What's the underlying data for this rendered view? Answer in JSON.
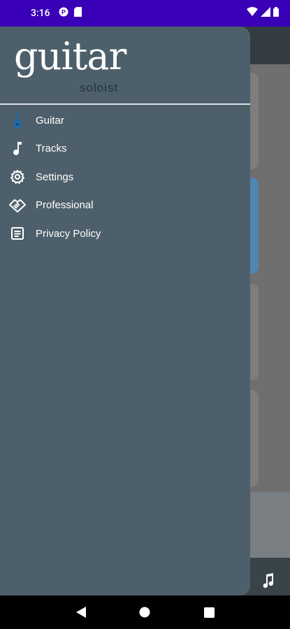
{
  "status_bar": {
    "time": "3:16",
    "left_icons": [
      "p-badge-icon",
      "sd-card-icon"
    ],
    "right_icons": [
      "wifi-icon",
      "signal-icon",
      "battery-icon"
    ]
  },
  "drawer": {
    "logo_title": "guitar",
    "logo_subtitle": "soloist",
    "menu": [
      {
        "label": "Guitar",
        "icon": "guitar-icon"
      },
      {
        "label": "Tracks",
        "icon": "music-note-icon"
      },
      {
        "label": "Settings",
        "icon": "gear-icon"
      },
      {
        "label": "Professional",
        "icon": "handshake-icon"
      },
      {
        "label": "Privacy Policy",
        "icon": "document-icon"
      }
    ]
  },
  "nav_bar": {
    "buttons": [
      "back-icon",
      "home-icon",
      "recents-icon"
    ]
  },
  "colors": {
    "status_bar": "#3a00b8",
    "drawer_bg": "#4d5f6a",
    "guitar_icon": "#1e6aa6"
  }
}
